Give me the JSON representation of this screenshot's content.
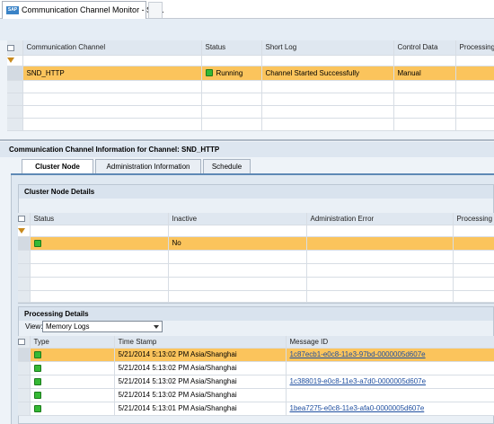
{
  "browser_tab": {
    "title": "Communication Channel Monitor - SA...",
    "logo": "SAP"
  },
  "channels_table": {
    "columns": [
      "Communication Channel",
      "Status",
      "Short Log",
      "Control Data",
      "Processing"
    ],
    "rows": [
      {
        "channel": "SND_HTTP",
        "status": "Running",
        "short_log": "Channel Started Successfully",
        "control_data": "Manual",
        "processing": ""
      }
    ]
  },
  "info_panel": {
    "title": "Communication Channel Information for Channel: SND_HTTP",
    "tabs": [
      "Cluster Node",
      "Administration Information",
      "Schedule"
    ]
  },
  "cluster_node": {
    "title": "Cluster Node Details",
    "columns": [
      "Status",
      "Inactive",
      "Administration Error",
      "Processing D"
    ],
    "rows": [
      {
        "status": "",
        "inactive": "No",
        "admin_error": "",
        "processing": ""
      }
    ]
  },
  "processing_details": {
    "title": "Processing Details",
    "view_label": "View:",
    "view_value": "Memory Logs",
    "columns": [
      "Type",
      "Time Stamp",
      "Message ID"
    ],
    "rows": [
      {
        "time": "5/21/2014 5:13:02 PM Asia/Shanghai",
        "message_id": "1c87ecb1-e0c8-11e3-97bd-0000005d607e"
      },
      {
        "time": "5/21/2014 5:13:02 PM Asia/Shanghai",
        "message_id": ""
      },
      {
        "time": "5/21/2014 5:13:02 PM Asia/Shanghai",
        "message_id": "1c388019-e0c8-11e3-a7d0-0000005d607e"
      },
      {
        "time": "5/21/2014 5:13:02 PM Asia/Shanghai",
        "message_id": ""
      },
      {
        "time": "5/21/2014 5:13:01 PM Asia/Shanghai",
        "message_id": "1bea7275-e0c8-11e3-afa0-0000005d607e"
      }
    ]
  },
  "colors": {
    "selected_row": "#fbc45c",
    "status_green": "#35b935",
    "header_blue": "#dfe7f0"
  }
}
